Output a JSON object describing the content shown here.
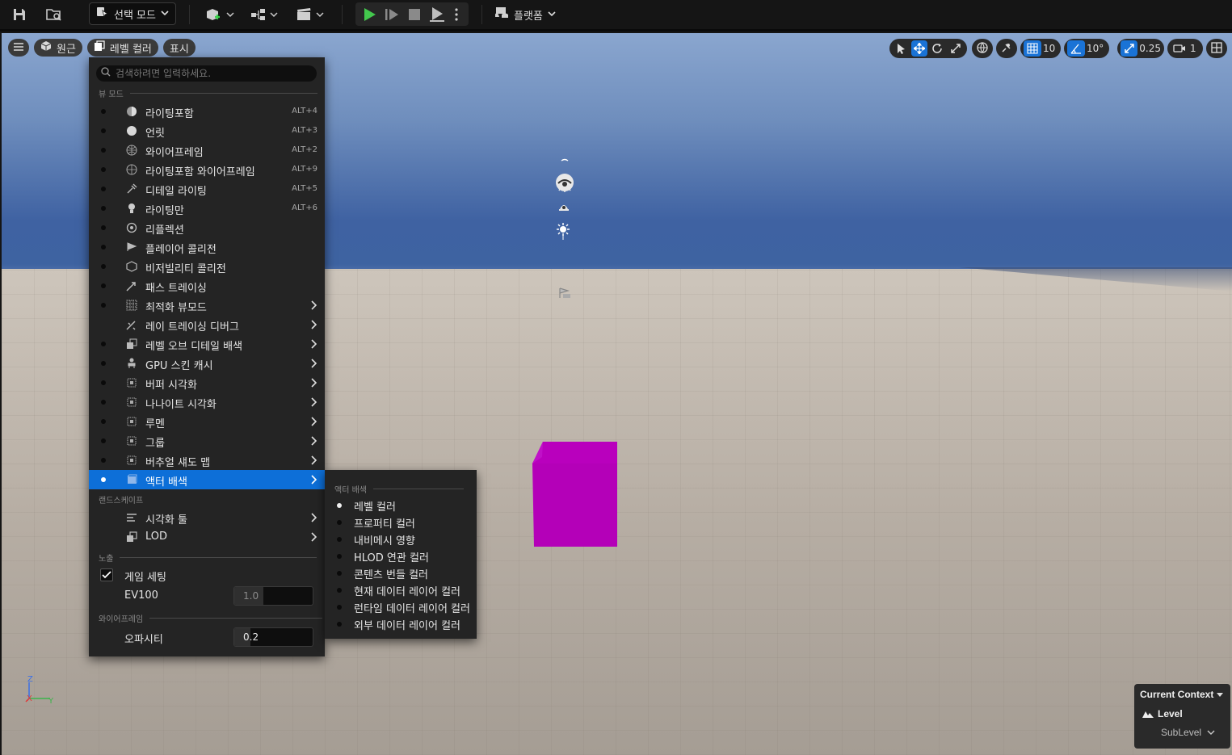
{
  "toolbar": {
    "mode_label": "선택 모드",
    "platform_label": "플랫폼",
    "icons": [
      "save-icon",
      "content-browser-icon",
      "mode-icon",
      "add-actor-icon",
      "blueprint-icon",
      "cinematics-icon",
      "play-icon",
      "advance-frame-icon",
      "stop-icon",
      "launch-icon",
      "more-options-icon",
      "platform-icon"
    ]
  },
  "viewport": {
    "perspective_label": "원근",
    "view_mode_label": "레벨 컬러",
    "show_label": "표시",
    "grid_snap": "10",
    "rotation_snap": "10°",
    "scale_snap": "0.25",
    "camera_speed": "1",
    "cube_color": "#b400b8"
  },
  "menu": {
    "search_placeholder": "검색하려면 입력하세요.",
    "section_view_mode": "뷰 모드",
    "items": [
      {
        "label": "라이팅포함",
        "shortcut": "ALT+4"
      },
      {
        "label": "언릿",
        "shortcut": "ALT+3"
      },
      {
        "label": "와이어프레임",
        "shortcut": "ALT+2"
      },
      {
        "label": "라이팅포함 와이어프레임",
        "shortcut": "ALT+9"
      },
      {
        "label": "디테일 라이팅",
        "shortcut": "ALT+5"
      },
      {
        "label": "라이팅만",
        "shortcut": "ALT+6"
      },
      {
        "label": "리플렉션",
        "shortcut": ""
      },
      {
        "label": "플레이어 콜리전",
        "shortcut": ""
      },
      {
        "label": "비저빌리티 콜리전",
        "shortcut": ""
      },
      {
        "label": "패스 트레이싱",
        "shortcut": ""
      },
      {
        "label": "최적화 뷰모드",
        "shortcut": ""
      },
      {
        "label": "레이 트레이싱 디버그",
        "shortcut": ""
      },
      {
        "label": "레벨 오브 디테일 배색",
        "shortcut": ""
      },
      {
        "label": "GPU 스킨 캐시",
        "shortcut": ""
      },
      {
        "label": "버퍼 시각화",
        "shortcut": ""
      },
      {
        "label": "나나이트 시각화",
        "shortcut": ""
      },
      {
        "label": "루멘",
        "shortcut": ""
      },
      {
        "label": "그룹",
        "shortcut": ""
      },
      {
        "label": "버추얼 섀도 맵",
        "shortcut": ""
      },
      {
        "label": "액터 배색",
        "shortcut": ""
      }
    ],
    "section_landscape": "랜드스케이프",
    "landscape_items": [
      {
        "label": "시각화 툴"
      },
      {
        "label": "LOD"
      }
    ],
    "section_exposure": "노출",
    "game_settings_label": "게임 세팅",
    "game_settings_checked": true,
    "ev100_label": "EV100",
    "ev100_value": "1.0",
    "section_wireframe": "와이어프레임",
    "opacity_label": "오파시티",
    "opacity_value": "0.2"
  },
  "submenu": {
    "section": "액터 배색",
    "items": [
      {
        "label": "레벨 컬러",
        "selected": true
      },
      {
        "label": "프로퍼티 컬러",
        "selected": false
      },
      {
        "label": "내비메시 영향",
        "selected": false
      },
      {
        "label": "HLOD 연관 컬러",
        "selected": false
      },
      {
        "label": "콘텐츠 번들 컬러",
        "selected": false
      },
      {
        "label": "현재 데이터 레이어 컬러",
        "selected": false
      },
      {
        "label": "런타임 데이터 레이어 컬러",
        "selected": false
      },
      {
        "label": "외부 데이터 레이어 컬러",
        "selected": false
      }
    ]
  },
  "context": {
    "title": "Current Context",
    "level": "Level",
    "sublevel": "SubLevel"
  },
  "axis": {
    "z": "Z",
    "x": "X",
    "y": "Y"
  }
}
